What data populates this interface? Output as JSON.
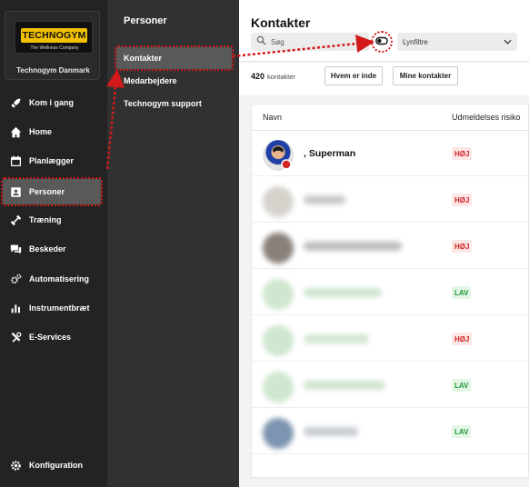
{
  "brand": {
    "logo_text": "TECHNOGYM",
    "tagline": "The Wellness Company",
    "org_name": "Technogym Danmark",
    "accent": "#f2c200"
  },
  "nav": {
    "items": [
      {
        "label": "Kom i gang",
        "icon": "rocket-icon"
      },
      {
        "label": "Home",
        "icon": "home-icon"
      },
      {
        "label": "Planlægger",
        "icon": "calendar-icon"
      },
      {
        "label": "Personer",
        "icon": "person-card-icon"
      },
      {
        "label": "Træning",
        "icon": "dumbbell-icon"
      },
      {
        "label": "Beskeder",
        "icon": "chat-icon"
      },
      {
        "label": "Automatisering",
        "icon": "gears-icon"
      },
      {
        "label": "Instrumentbræt",
        "icon": "bar-chart-icon"
      },
      {
        "label": "E-Services",
        "icon": "tools-icon"
      }
    ],
    "config_label": "Konfiguration"
  },
  "subnav": {
    "title": "Personer",
    "items": [
      {
        "label": "Kontakter"
      },
      {
        "label": "Medarbejdere"
      },
      {
        "label": "Technogym support"
      }
    ]
  },
  "main": {
    "title": "Kontakter",
    "search_placeholder": "Søg",
    "quick_filter_label": "Lynfiltre",
    "count_value": "420",
    "count_label": "kontakter",
    "btn_inside": "Hvem er inde",
    "btn_mine": "Mine kontakter",
    "table": {
      "col_name": "Navn",
      "col_risk": "Udmeldelses risiko",
      "rows": [
        {
          "name": ", Superman",
          "risk": "HØJ"
        },
        {
          "name": "",
          "risk": "HØJ"
        },
        {
          "name": "",
          "risk": "HØJ"
        },
        {
          "name": "",
          "risk": "LAV"
        },
        {
          "name": "",
          "risk": "HØJ"
        },
        {
          "name": "",
          "risk": "LAV"
        },
        {
          "name": "",
          "risk": "LAV"
        }
      ]
    }
  },
  "colors": {
    "highlight": "#d21a1a",
    "risk_high": "#d02424",
    "risk_low": "#1f9a3a"
  }
}
